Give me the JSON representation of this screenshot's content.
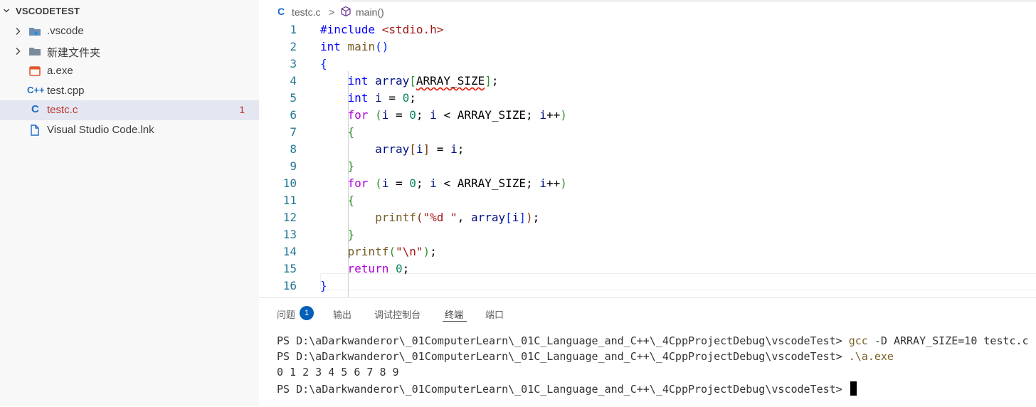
{
  "explorer": {
    "title": "VSCODETEST",
    "items": [
      {
        "label": ".vscode",
        "type": "folder",
        "icon": "vscode-folder-icon"
      },
      {
        "label": "新建文件夹",
        "type": "folder",
        "icon": "folder-icon"
      },
      {
        "label": "a.exe",
        "type": "file",
        "icon": "exe-icon"
      },
      {
        "label": "test.cpp",
        "type": "file",
        "icon": "cpp-icon"
      },
      {
        "label": "testc.c",
        "type": "file",
        "icon": "c-icon",
        "problems": "1",
        "selected": true
      },
      {
        "label": "Visual Studio Code.lnk",
        "type": "file",
        "icon": "file-icon"
      }
    ]
  },
  "breadcrumb": {
    "file": "testc.c",
    "separator": ">",
    "symbol": "main()"
  },
  "editor": {
    "line_numbers": [
      "1",
      "2",
      "3",
      "4",
      "5",
      "6",
      "7",
      "8",
      "9",
      "10",
      "11",
      "12",
      "13",
      "14",
      "15",
      "16"
    ]
  },
  "panel": {
    "tabs": [
      "问题",
      "输出",
      "调试控制台",
      "终端",
      "端口"
    ],
    "active_tab": "终端",
    "problems_badge": "1"
  },
  "terminal": {
    "prompt": "PS D:\\aDarkwanderor\\_01ComputerLearn\\_01C_Language_and_C++\\_4CppProjectDebug\\vscodeTest>",
    "cmd1": "gcc",
    "cmd1_args": "-D ARRAY_SIZE=10 testc.c",
    "cmd2": ".\\a.exe",
    "output": "0 1 2 3 4 5 6 7 8 9"
  },
  "colors": {
    "accent": "#005fb8",
    "selected_row": "#e4e6f1",
    "line_number": "#237893",
    "error_text": "#b8352a"
  }
}
